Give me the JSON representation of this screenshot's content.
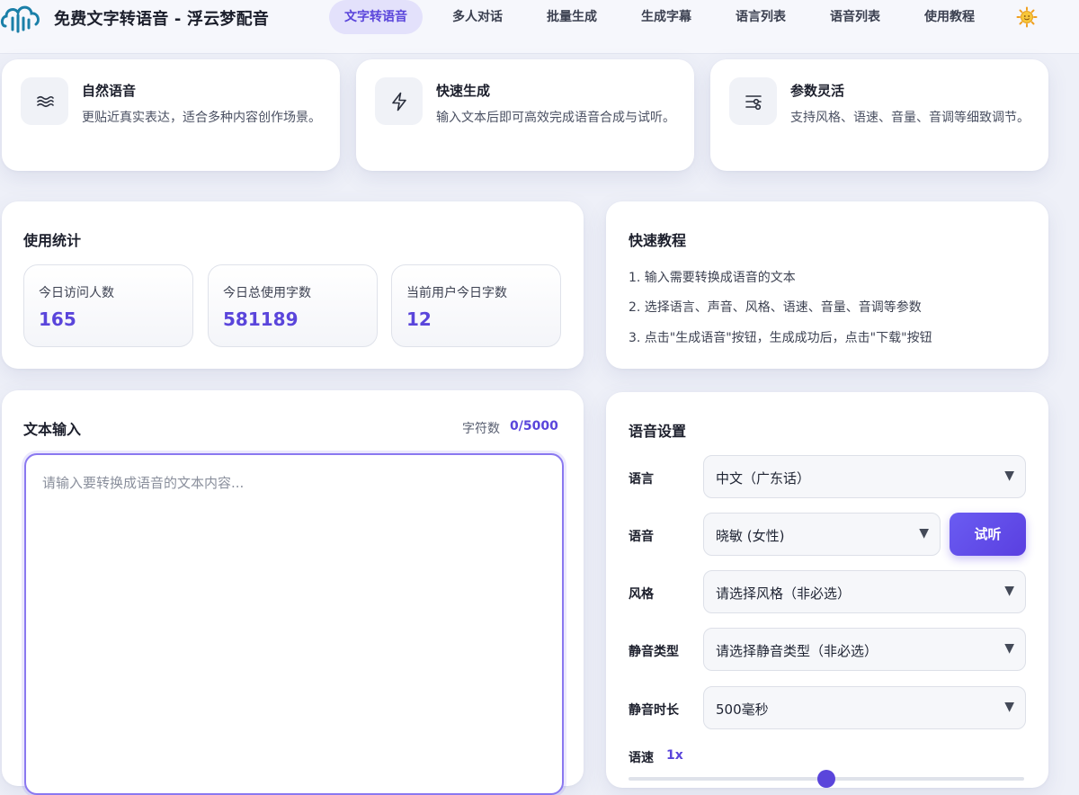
{
  "header": {
    "title": "免费文字转语音 - 浮云梦配音",
    "nav": [
      {
        "label": "文字转语音",
        "active": true
      },
      {
        "label": "多人对话",
        "active": false
      },
      {
        "label": "批量生成",
        "active": false
      },
      {
        "label": "生成字幕",
        "active": false
      },
      {
        "label": "语言列表",
        "active": false
      },
      {
        "label": "语音列表",
        "active": false
      },
      {
        "label": "使用教程",
        "active": false
      }
    ],
    "theme_icon": "sun-icon"
  },
  "features": [
    {
      "icon": "wave-icon",
      "title": "自然语音",
      "desc": "更贴近真实表达，适合多种内容创作场景。"
    },
    {
      "icon": "lightning-icon",
      "title": "快速生成",
      "desc": "输入文本后即可高效完成语音合成与试听。"
    },
    {
      "icon": "sliders-icon",
      "title": "参数灵活",
      "desc": "支持风格、语速、音量、音调等细致调节。"
    }
  ],
  "stats": {
    "title": "使用统计",
    "items": [
      {
        "label": "今日访问人数",
        "value": "165"
      },
      {
        "label": "今日总使用字数",
        "value": "581189"
      },
      {
        "label": "当前用户今日字数",
        "value": "12"
      }
    ]
  },
  "tutorial": {
    "title": "快速教程",
    "steps": [
      "1. 输入需要转换成语音的文本",
      "2. 选择语言、声音、风格、语速、音量、音调等参数",
      "3. 点击\"生成语音\"按钮，生成成功后，点击\"下载\"按钮"
    ]
  },
  "text_input": {
    "title": "文本输入",
    "char_count_label": "字符数",
    "char_count_value": "0/5000",
    "placeholder": "请输入要转换成语音的文本内容..."
  },
  "settings": {
    "title": "语音设置",
    "language": {
      "label": "语言",
      "value": "中文（广东话）"
    },
    "voice": {
      "label": "语音",
      "value": "晓敏 (女性)"
    },
    "listen_button": "试听",
    "style": {
      "label": "风格",
      "value": "请选择风格（非必选）"
    },
    "silence_type": {
      "label": "静音类型",
      "value": "请选择静音类型（非必选）"
    },
    "silence_duration": {
      "label": "静音时长",
      "value": "500毫秒"
    },
    "speed": {
      "label": "语速",
      "value": "1x",
      "level": 0.5
    },
    "arrow": "▼"
  },
  "colors": {
    "accent": "#5a45db",
    "active_bg": "#e3e1fb"
  }
}
